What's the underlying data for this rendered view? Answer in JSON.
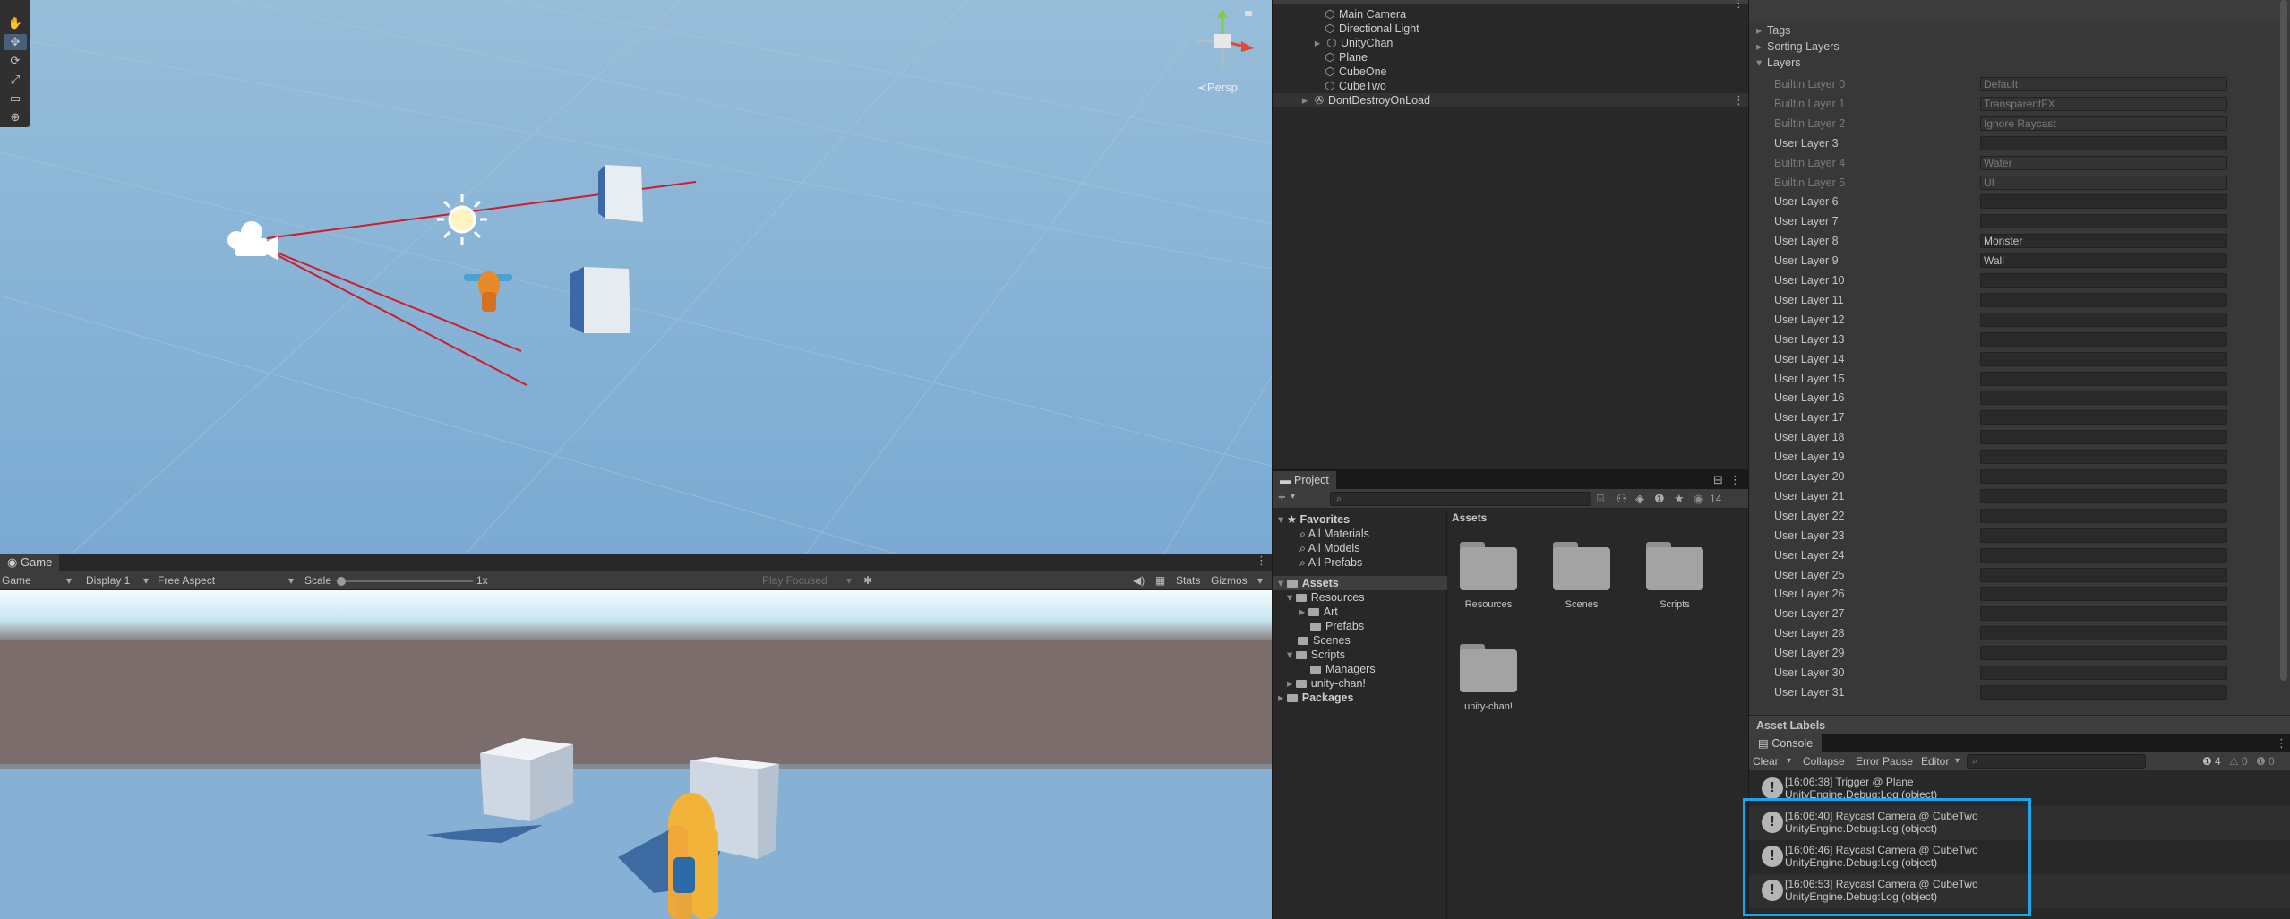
{
  "scene_view": {
    "tools": [
      "✋",
      "✥",
      "⟳",
      "⤢",
      "▭",
      "⊕"
    ],
    "persp_label": "≺Persp"
  },
  "game_view": {
    "tab_label": "Game",
    "bar": {
      "mode": "Game",
      "display": "Display 1",
      "aspect": "Free Aspect",
      "scale_label": "Scale",
      "scale_value": "1x",
      "play_focused": "Play Focused",
      "stats": "Stats",
      "gizmos": "Gizmos"
    }
  },
  "hierarchy": {
    "items": [
      {
        "label": "Main Camera"
      },
      {
        "label": "Directional Light"
      },
      {
        "label": "UnityChan"
      },
      {
        "label": "Plane"
      },
      {
        "label": "CubeOne"
      },
      {
        "label": "CubeTwo"
      },
      {
        "label": "DontDestroyOnLoad"
      }
    ]
  },
  "project": {
    "tab_label": "Project",
    "hidden_count": "14",
    "favorites_label": "Favorites",
    "favorites": [
      "All Materials",
      "All Models",
      "All Prefabs"
    ],
    "assets_label": "Assets",
    "tree": [
      "Resources",
      "Art",
      "Prefabs",
      "Scenes",
      "Scripts",
      "Managers",
      "unity-chan!"
    ],
    "packages_label": "Packages",
    "grid_title": "Assets",
    "grid_items": [
      "Resources",
      "Scenes",
      "Scripts",
      "unity-chan!"
    ]
  },
  "inspector": {
    "sections": [
      "Tags",
      "Sorting Layers",
      "Layers"
    ],
    "layers": [
      {
        "label": "Builtin Layer 0",
        "value": "Default"
      },
      {
        "label": "Builtin Layer 1",
        "value": "TransparentFX"
      },
      {
        "label": "Builtin Layer 2",
        "value": "Ignore Raycast"
      },
      {
        "label": "User Layer 3",
        "value": ""
      },
      {
        "label": "Builtin Layer 4",
        "value": "Water"
      },
      {
        "label": "Builtin Layer 5",
        "value": "UI"
      },
      {
        "label": "User Layer 6",
        "value": ""
      },
      {
        "label": "User Layer 7",
        "value": ""
      },
      {
        "label": "User Layer 8",
        "value": "Monster"
      },
      {
        "label": "User Layer 9",
        "value": "Wall"
      },
      {
        "label": "User Layer 10",
        "value": ""
      },
      {
        "label": "User Layer 11",
        "value": ""
      },
      {
        "label": "User Layer 12",
        "value": ""
      },
      {
        "label": "User Layer 13",
        "value": ""
      },
      {
        "label": "User Layer 14",
        "value": ""
      },
      {
        "label": "User Layer 15",
        "value": ""
      },
      {
        "label": "User Layer 16",
        "value": ""
      },
      {
        "label": "User Layer 17",
        "value": ""
      },
      {
        "label": "User Layer 18",
        "value": ""
      },
      {
        "label": "User Layer 19",
        "value": ""
      },
      {
        "label": "User Layer 20",
        "value": ""
      },
      {
        "label": "User Layer 21",
        "value": ""
      },
      {
        "label": "User Layer 22",
        "value": ""
      },
      {
        "label": "User Layer 23",
        "value": ""
      },
      {
        "label": "User Layer 24",
        "value": ""
      },
      {
        "label": "User Layer 25",
        "value": ""
      },
      {
        "label": "User Layer 26",
        "value": ""
      },
      {
        "label": "User Layer 27",
        "value": ""
      },
      {
        "label": "User Layer 28",
        "value": ""
      },
      {
        "label": "User Layer 29",
        "value": ""
      },
      {
        "label": "User Layer 30",
        "value": ""
      },
      {
        "label": "User Layer 31",
        "value": ""
      }
    ],
    "asset_labels": "Asset Labels"
  },
  "console": {
    "tab_label": "Console",
    "clear": "Clear",
    "collapse": "Collapse",
    "error_pause": "Error Pause",
    "editor": "Editor",
    "count_log": "4",
    "count_warn": "0",
    "count_err": "0",
    "entries": [
      {
        "line1": "[16:06:38] Trigger @ Plane",
        "line2": "UnityEngine.Debug:Log (object)"
      },
      {
        "line1": "[16:06:40] Raycast Camera @ CubeTwo",
        "line2": "UnityEngine.Debug:Log (object)"
      },
      {
        "line1": "[16:06:46] Raycast Camera @ CubeTwo",
        "line2": "UnityEngine.Debug:Log (object)"
      },
      {
        "line1": "[16:06:53] Raycast Camera @ CubeTwo",
        "line2": "UnityEngine.Debug:Log (object)"
      }
    ]
  },
  "colors": {
    "highlight": "#1aa6e8",
    "ray": "#d11a2a",
    "accent": "#46607c"
  }
}
